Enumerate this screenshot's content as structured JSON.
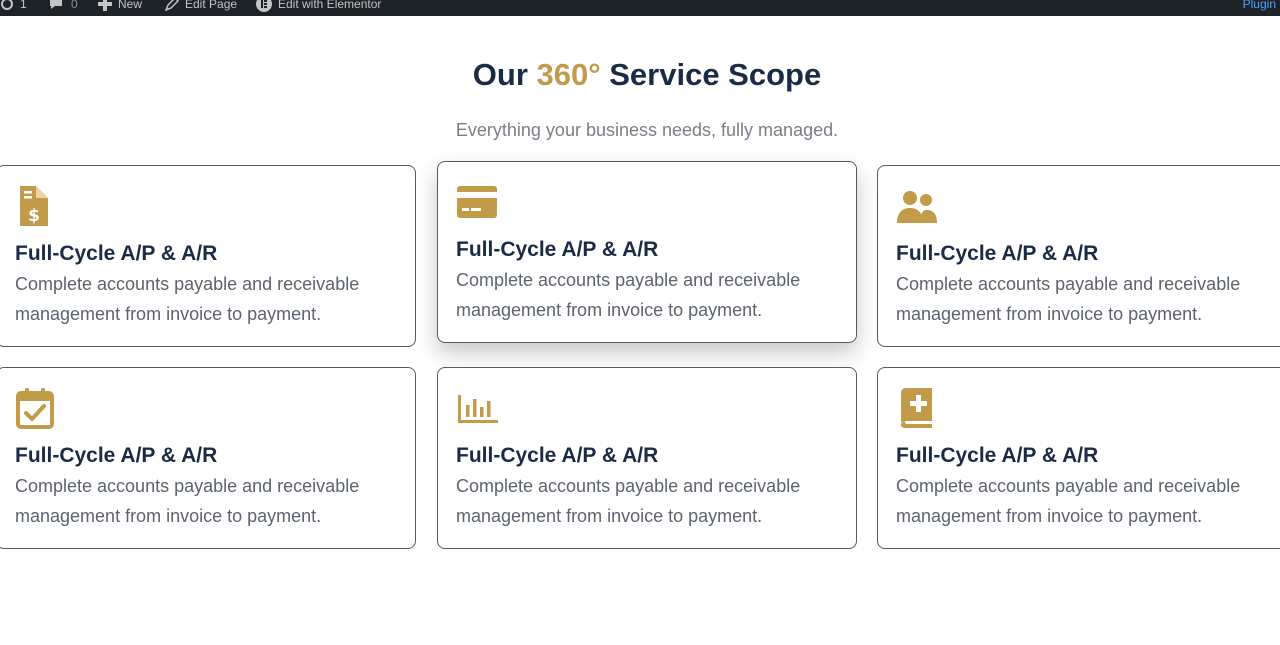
{
  "adminbar": {
    "comments_count": "0",
    "updates_count": "1",
    "new_label": "New",
    "edit_page_label": "Edit Page",
    "elementor_label": "Edit with Elementor",
    "right_label": "Plugin"
  },
  "section": {
    "title_prefix": "Our ",
    "title_accent": "360°",
    "title_suffix": " Service Scope",
    "subtitle": "Everything your business needs, fully managed."
  },
  "cards": [
    {
      "icon": "invoice-dollar-icon",
      "title": "Full-Cycle A/P & A/R",
      "description": "Complete accounts payable and receivable management from invoice to payment."
    },
    {
      "icon": "credit-card-icon",
      "title": "Full-Cycle A/P & A/R",
      "description": "Complete accounts payable and receivable management from invoice to payment."
    },
    {
      "icon": "users-icon",
      "title": "Full-Cycle A/P & A/R",
      "description": "Complete accounts payable and receivable management from invoice to payment."
    },
    {
      "icon": "calendar-check-icon",
      "title": "Full-Cycle A/P & A/R",
      "description": "Complete accounts payable and receivable management from invoice to payment."
    },
    {
      "icon": "bar-chart-icon",
      "title": "Full-Cycle A/P & A/R",
      "description": "Complete accounts payable and receivable management from invoice to payment."
    },
    {
      "icon": "medical-book-icon",
      "title": "Full-Cycle A/P & A/R",
      "description": "Complete accounts payable and receivable management from invoice to payment."
    }
  ],
  "colors": {
    "accent": "#c19a4a",
    "navy": "#1c2b45",
    "admin_bar": "#1d2327"
  }
}
